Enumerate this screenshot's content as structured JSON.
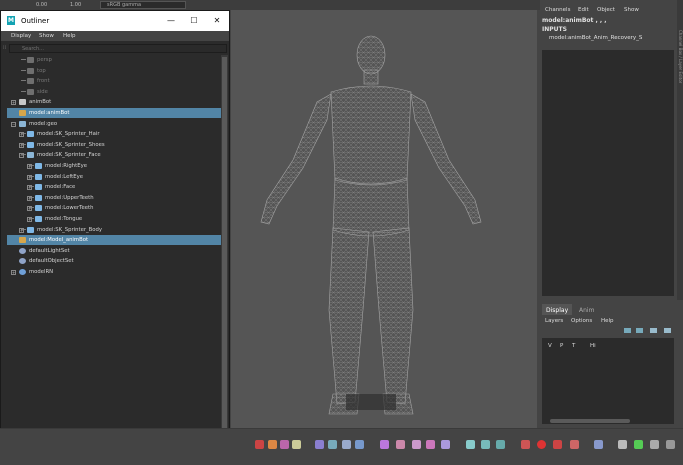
{
  "top_strip": {
    "value_a": "0.00",
    "value_b": "1.00",
    "color_space": "sRGB gamma"
  },
  "outliner": {
    "title": "Outliner",
    "window_buttons": {
      "minimize": "—",
      "maximize": "☐",
      "close": "✕"
    },
    "menu": [
      "Display",
      "Show",
      "Help"
    ],
    "search_placeholder": "Search...",
    "items": [
      {
        "label": "persp",
        "depth": 1,
        "kind": "camera",
        "dim": true
      },
      {
        "label": "top",
        "depth": 1,
        "kind": "camera",
        "dim": true
      },
      {
        "label": "front",
        "depth": 1,
        "kind": "camera",
        "dim": true
      },
      {
        "label": "side",
        "depth": 1,
        "kind": "camera",
        "dim": true
      },
      {
        "label": "animBot",
        "depth": 0,
        "kind": "magnet",
        "expander": "+"
      },
      {
        "label": "model:animBot",
        "depth": 0,
        "kind": "ref",
        "selected": true
      },
      {
        "label": "model:geo",
        "depth": 0,
        "kind": "group",
        "expander": "−"
      },
      {
        "label": "model:SK_Sprinter_Hair",
        "depth": 1,
        "kind": "mesh",
        "expander": "+"
      },
      {
        "label": "model:SK_Sprinter_Shoes",
        "depth": 1,
        "kind": "mesh",
        "expander": "+"
      },
      {
        "label": "model:SK_Sprinter_Face",
        "depth": 1,
        "kind": "group",
        "expander": "−"
      },
      {
        "label": "model:RightEye",
        "depth": 2,
        "kind": "mesh",
        "expander": "+"
      },
      {
        "label": "model:LeftEye",
        "depth": 2,
        "kind": "mesh",
        "expander": "+"
      },
      {
        "label": "model:Face",
        "depth": 2,
        "kind": "mesh",
        "expander": "+"
      },
      {
        "label": "model:UpperTeeth",
        "depth": 2,
        "kind": "mesh",
        "expander": "+"
      },
      {
        "label": "model:LowerTeeth",
        "depth": 2,
        "kind": "mesh",
        "expander": "+"
      },
      {
        "label": "model:Tongue",
        "depth": 2,
        "kind": "mesh",
        "expander": "+"
      },
      {
        "label": "model:SK_Sprinter_Body",
        "depth": 1,
        "kind": "mesh",
        "expander": "+"
      },
      {
        "label": "model:Model_animBot",
        "depth": 0,
        "kind": "ref",
        "selected": true
      },
      {
        "label": "defaultLightSet",
        "depth": 0,
        "kind": "set"
      },
      {
        "label": "defaultObjectSet",
        "depth": 0,
        "kind": "set"
      },
      {
        "label": "modelRN",
        "depth": 0,
        "kind": "refnode",
        "expander": "+"
      }
    ]
  },
  "channel_box": {
    "menu": [
      "Channels",
      "Edit",
      "Object",
      "Show"
    ],
    "node_name": "model:animBot , , ,",
    "inputs_label": "INPUTS",
    "input_node": "model:animBot_Anim_Recovery_S",
    "side_tab": "Channel Box / Layer Editor"
  },
  "layer_editor": {
    "tabs": [
      "Display",
      "Anim"
    ],
    "menu": [
      "Layers",
      "Options",
      "Help"
    ],
    "columns": [
      "V",
      "P",
      "T",
      "Hi"
    ]
  },
  "colors": {
    "selection": "#5285a6",
    "panel_bg": "#444444",
    "list_bg": "#2b2b2b",
    "viewport_bg": "#555555",
    "wireframe": "#9a9a9a"
  }
}
